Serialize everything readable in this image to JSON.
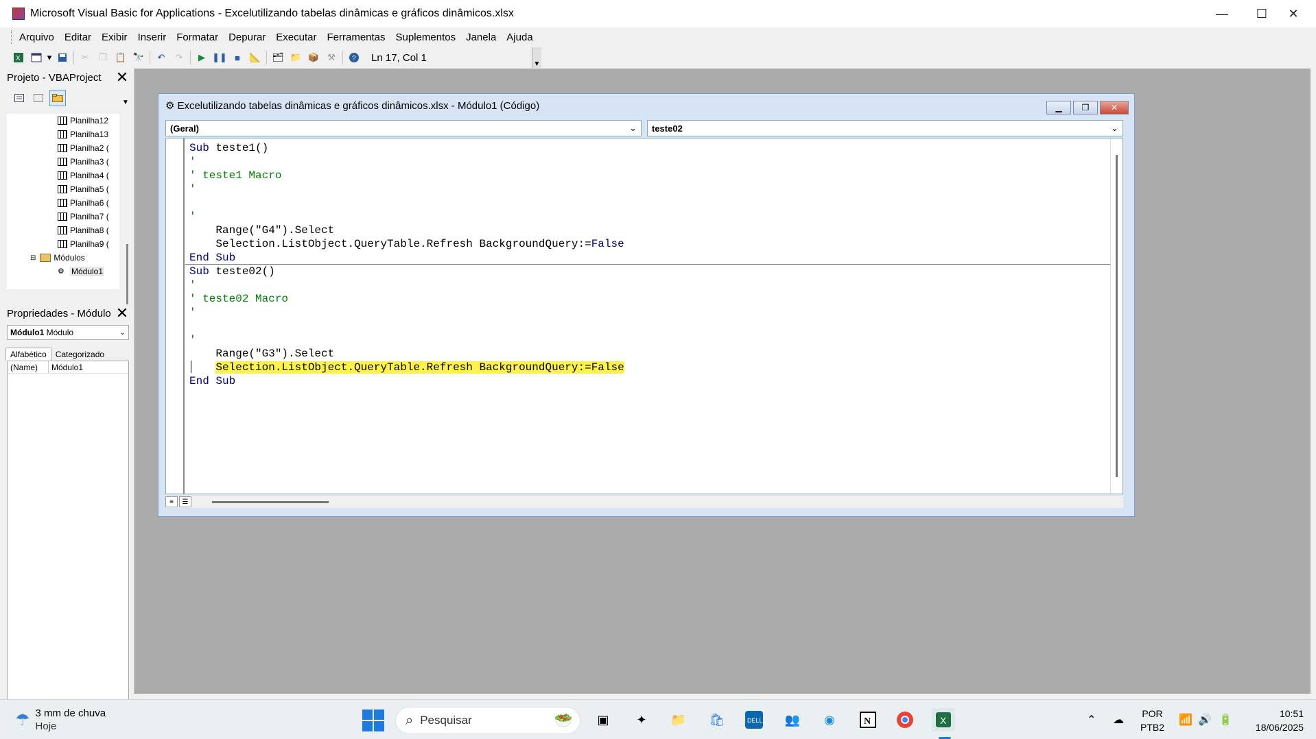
{
  "window": {
    "title": "Microsoft Visual Basic for Applications - Excelutilizando tabelas dinâmicas e gráficos dinâmicos.xlsx",
    "minimize": "—",
    "maximize": "☐",
    "close": "✕"
  },
  "menu": [
    "Arquivo",
    "Editar",
    "Exibir",
    "Inserir",
    "Formatar",
    "Depurar",
    "Executar",
    "Ferramentas",
    "Suplementos",
    "Janela",
    "Ajuda"
  ],
  "toolbar": {
    "status": "Ln 17, Col 1",
    "icons": [
      "excel-icon",
      "insert-form-icon",
      "save-icon",
      "cut-icon",
      "copy-icon",
      "paste-icon",
      "find-icon",
      "undo-icon",
      "redo-icon",
      "run-icon",
      "break-icon",
      "reset-icon",
      "design-mode-icon",
      "project-explorer-icon",
      "properties-icon",
      "object-browser-icon",
      "toolbox-icon",
      "help-icon"
    ]
  },
  "project_panel": {
    "title": "Projeto - VBAProject",
    "close": "✕",
    "items": [
      {
        "label": "Planilha12",
        "type": "sheet",
        "indent": 2
      },
      {
        "label": "Planilha13",
        "type": "sheet",
        "indent": 2
      },
      {
        "label": "Planilha2 (",
        "type": "sheet",
        "indent": 2
      },
      {
        "label": "Planilha3 (",
        "type": "sheet",
        "indent": 2
      },
      {
        "label": "Planilha4 (",
        "type": "sheet",
        "indent": 2
      },
      {
        "label": "Planilha5 (",
        "type": "sheet",
        "indent": 2
      },
      {
        "label": "Planilha6 (",
        "type": "sheet",
        "indent": 2
      },
      {
        "label": "Planilha7 (",
        "type": "sheet",
        "indent": 2
      },
      {
        "label": "Planilha8 (",
        "type": "sheet",
        "indent": 2
      },
      {
        "label": "Planilha9 (",
        "type": "sheet",
        "indent": 2
      },
      {
        "label": "Módulos",
        "type": "folder",
        "indent": 1
      },
      {
        "label": "Módulo1",
        "type": "module",
        "indent": 2
      }
    ]
  },
  "properties_panel": {
    "title": "Propriedades - Módulo",
    "close": "✕",
    "selected_object_bold": "Módulo1",
    "selected_object_type": "Módulo",
    "tabs": [
      "Alfabético",
      "Categorizado"
    ],
    "rows": [
      {
        "key": "(Name)",
        "value": "Módulo1"
      }
    ]
  },
  "code_window": {
    "title": "Excelutilizando tabelas dinâmicas e gráficos dinâmicos.xlsx - Módulo1 (Código)",
    "object_combo": "(Geral)",
    "procedure_combo": "teste02",
    "lines": [
      [
        {
          "t": "Sub",
          "c": "kw"
        },
        {
          "t": " teste1()",
          "c": ""
        }
      ],
      [
        {
          "t": "'",
          "c": "cm"
        }
      ],
      [
        {
          "t": "' teste1 Macro",
          "c": "cm"
        }
      ],
      [
        {
          "t": "'",
          "c": "cm"
        }
      ],
      [
        {
          "t": "",
          "c": ""
        }
      ],
      [
        {
          "t": "'",
          "c": "cm"
        }
      ],
      [
        {
          "t": "    Range(\"G4\").Select",
          "c": ""
        }
      ],
      [
        {
          "t": "    Selection.ListObject.QueryTable.Refresh BackgroundQuery:=",
          "c": ""
        },
        {
          "t": "False",
          "c": "kw"
        }
      ],
      [
        {
          "t": "End Sub",
          "c": "kw"
        }
      ],
      [
        {
          "t": "Sub",
          "c": "kw"
        },
        {
          "t": " teste02()",
          "c": ""
        }
      ],
      [
        {
          "t": "'",
          "c": "cm"
        }
      ],
      [
        {
          "t": "' teste02 Macro",
          "c": "cm"
        }
      ],
      [
        {
          "t": "'",
          "c": "cm"
        }
      ],
      [
        {
          "t": "",
          "c": ""
        }
      ],
      [
        {
          "t": "'",
          "c": "cm"
        }
      ],
      [
        {
          "t": "    Range(\"G3\").Select",
          "c": ""
        }
      ],
      [
        {
          "t": "    ",
          "c": ""
        },
        {
          "t": "Selection.ListObject.QueryTable.Refresh BackgroundQuery:=False",
          "c": "hl"
        }
      ],
      [
        {
          "t": "End Sub",
          "c": "kw"
        }
      ]
    ]
  },
  "taskbar": {
    "weather_main": "3 mm de chuva",
    "weather_sub": "Hoje",
    "search_placeholder": "Pesquisar",
    "apps": [
      "food-widget-icon",
      "task-view-icon",
      "copilot-icon",
      "file-explorer-icon",
      "store-icon",
      "dell-icon",
      "teams-icon",
      "edge-icon",
      "notion-icon",
      "chrome-icon",
      "excel-icon"
    ],
    "lang_top": "POR",
    "lang_bottom": "PTB2",
    "time": "10:51",
    "date": "18/06/2025"
  },
  "colors": {
    "keyword": "#00008b",
    "comment": "#008000",
    "highlight": "#fff34a",
    "mdi_background": "#ababab"
  }
}
